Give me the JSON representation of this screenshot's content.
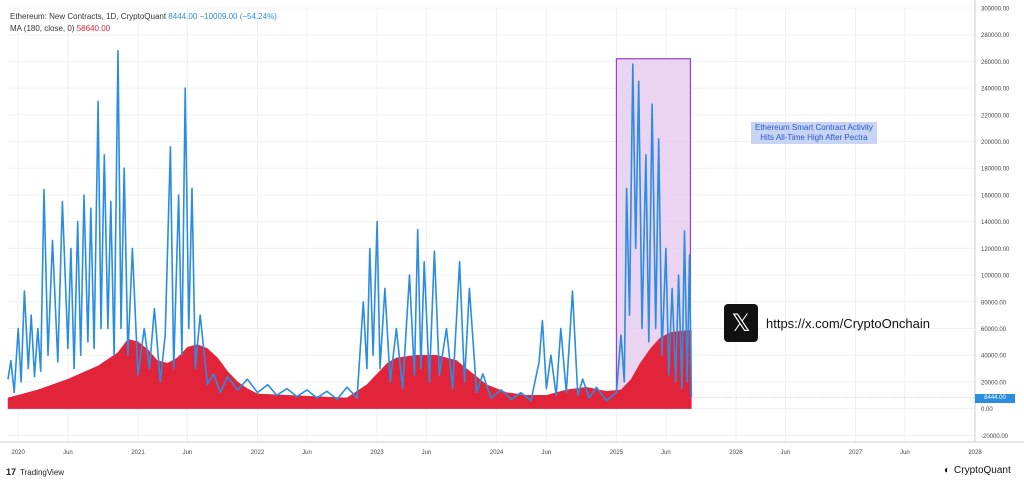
{
  "legend": {
    "title": "Ethereum: New Contracts, 1D, CryptoQuant",
    "last_value": "8444.00",
    "change": "−10009.00 (−54.24%)",
    "ma_label": "MA (180, close, 0)",
    "ma_value": "58640.00"
  },
  "annotation": {
    "line1": "Ethereum Smart Contract Activity",
    "line2": "Hits All-Time High After Pectra"
  },
  "social": {
    "icon": "x-logo-icon",
    "url": "https://x.com/CryptoOnchain"
  },
  "footer": {
    "tradingview": "TradingView",
    "cryptoquant": "CryptoQuant"
  },
  "colors": {
    "contracts": "#2a8de0",
    "ma": "#e2243b",
    "highlight_fill": "#e7cdf0",
    "highlight_border": "#9c3fc9",
    "annotation_bg": "#c7d5f2"
  },
  "chart_data": {
    "type": "line",
    "title": "Ethereum: New Contracts, 1D, CryptoQuant",
    "ylim": [
      -25000,
      300000
    ],
    "xlim": [
      "2019-12-01",
      "2028-01-01"
    ],
    "y_ticks": [
      {
        "value": 300000,
        "label": "300000.00"
      },
      {
        "value": 280000,
        "label": "280000.00"
      },
      {
        "value": 260000,
        "label": "260000.00"
      },
      {
        "value": 240000,
        "label": "240000.00"
      },
      {
        "value": 220000,
        "label": "220000.00"
      },
      {
        "value": 200000,
        "label": "200000.00"
      },
      {
        "value": 180000,
        "label": "180000.00"
      },
      {
        "value": 160000,
        "label": "160000.00"
      },
      {
        "value": 140000,
        "label": "140000.00"
      },
      {
        "value": 120000,
        "label": "120000.00"
      },
      {
        "value": 100000,
        "label": "100000.00"
      },
      {
        "value": 80000,
        "label": "80000.00"
      },
      {
        "value": 60000,
        "label": "60000.00"
      },
      {
        "value": 40000,
        "label": "40000.00"
      },
      {
        "value": 20000,
        "label": "20000.00"
      },
      {
        "value": 0,
        "label": "0.00"
      },
      {
        "value": -20000,
        "label": "-20000.00"
      }
    ],
    "x_ticks": [
      {
        "date": "2020-01-01",
        "label": "2020"
      },
      {
        "date": "2020-06-01",
        "label": "Jun"
      },
      {
        "date": "2021-01-01",
        "label": "2021"
      },
      {
        "date": "2021-06-01",
        "label": "Jun"
      },
      {
        "date": "2022-01-01",
        "label": "2022"
      },
      {
        "date": "2022-06-01",
        "label": "Jun"
      },
      {
        "date": "2023-01-01",
        "label": "2023"
      },
      {
        "date": "2023-06-01",
        "label": "Jun"
      },
      {
        "date": "2024-01-01",
        "label": "2024"
      },
      {
        "date": "2024-06-01",
        "label": "Jun"
      },
      {
        "date": "2025-01-01",
        "label": "2025"
      },
      {
        "date": "2025-06-01",
        "label": "Jun"
      },
      {
        "date": "2026-01-01",
        "label": "2026"
      },
      {
        "date": "2026-06-01",
        "label": "Jun"
      },
      {
        "date": "2027-01-01",
        "label": "2027"
      },
      {
        "date": "2027-06-01",
        "label": "Jun"
      },
      {
        "date": "2028-01-01",
        "label": "2028"
      }
    ],
    "highlight": {
      "start": "2025-01-01",
      "end": "2025-08-15",
      "y_low": 6000,
      "y_high": 262000
    },
    "last_value_label": "8444.00",
    "series": [
      {
        "name": "Ethereum: New Contracts",
        "style": "line",
        "points": [
          [
            "2019-12-01",
            22000
          ],
          [
            "2019-12-10",
            36000
          ],
          [
            "2019-12-20",
            12000
          ],
          [
            "2020-01-01",
            60000
          ],
          [
            "2020-01-10",
            20000
          ],
          [
            "2020-01-20",
            88000
          ],
          [
            "2020-02-01",
            30000
          ],
          [
            "2020-02-10",
            70000
          ],
          [
            "2020-02-20",
            24000
          ],
          [
            "2020-03-01",
            60000
          ],
          [
            "2020-03-10",
            28000
          ],
          [
            "2020-03-20",
            164000
          ],
          [
            "2020-04-01",
            40000
          ],
          [
            "2020-04-15",
            126000
          ],
          [
            "2020-05-01",
            35000
          ],
          [
            "2020-05-15",
            155000
          ],
          [
            "2020-06-01",
            45000
          ],
          [
            "2020-06-10",
            120000
          ],
          [
            "2020-06-20",
            30000
          ],
          [
            "2020-07-01",
            140000
          ],
          [
            "2020-07-10",
            40000
          ],
          [
            "2020-07-20",
            160000
          ],
          [
            "2020-08-01",
            50000
          ],
          [
            "2020-08-10",
            150000
          ],
          [
            "2020-08-20",
            45000
          ],
          [
            "2020-09-01",
            230000
          ],
          [
            "2020-09-10",
            60000
          ],
          [
            "2020-09-20",
            190000
          ],
          [
            "2020-10-01",
            60000
          ],
          [
            "2020-10-10",
            155000
          ],
          [
            "2020-10-20",
            40000
          ],
          [
            "2020-11-01",
            268000
          ],
          [
            "2020-11-10",
            60000
          ],
          [
            "2020-11-20",
            180000
          ],
          [
            "2020-12-01",
            40000
          ],
          [
            "2020-12-15",
            120000
          ],
          [
            "2021-01-01",
            25000
          ],
          [
            "2021-01-20",
            60000
          ],
          [
            "2021-02-05",
            30000
          ],
          [
            "2021-02-20",
            75000
          ],
          [
            "2021-03-10",
            20000
          ],
          [
            "2021-03-25",
            55000
          ],
          [
            "2021-04-10",
            196000
          ],
          [
            "2021-04-20",
            30000
          ],
          [
            "2021-05-05",
            160000
          ],
          [
            "2021-05-15",
            40000
          ],
          [
            "2021-05-25",
            240000
          ],
          [
            "2021-06-05",
            60000
          ],
          [
            "2021-06-15",
            165000
          ],
          [
            "2021-06-25",
            30000
          ],
          [
            "2021-07-10",
            70000
          ],
          [
            "2021-08-01",
            18000
          ],
          [
            "2021-08-20",
            26000
          ],
          [
            "2021-09-10",
            12000
          ],
          [
            "2021-10-01",
            24000
          ],
          [
            "2021-11-01",
            14000
          ],
          [
            "2021-12-01",
            22000
          ],
          [
            "2022-01-01",
            12000
          ],
          [
            "2022-02-01",
            18000
          ],
          [
            "2022-03-01",
            10000
          ],
          [
            "2022-04-01",
            15000
          ],
          [
            "2022-05-01",
            9000
          ],
          [
            "2022-06-01",
            14000
          ],
          [
            "2022-07-01",
            8000
          ],
          [
            "2022-08-01",
            13000
          ],
          [
            "2022-09-01",
            7000
          ],
          [
            "2022-10-01",
            16000
          ],
          [
            "2022-11-01",
            8000
          ],
          [
            "2022-11-20",
            80000
          ],
          [
            "2022-12-01",
            30000
          ],
          [
            "2022-12-10",
            120000
          ],
          [
            "2022-12-20",
            40000
          ],
          [
            "2023-01-01",
            140000
          ],
          [
            "2023-01-10",
            30000
          ],
          [
            "2023-01-25",
            90000
          ],
          [
            "2023-02-10",
            20000
          ],
          [
            "2023-03-01",
            60000
          ],
          [
            "2023-03-20",
            15000
          ],
          [
            "2023-04-10",
            100000
          ],
          [
            "2023-04-25",
            25000
          ],
          [
            "2023-05-05",
            134000
          ],
          [
            "2023-05-15",
            30000
          ],
          [
            "2023-05-25",
            110000
          ],
          [
            "2023-06-10",
            20000
          ],
          [
            "2023-06-25",
            118000
          ],
          [
            "2023-07-10",
            25000
          ],
          [
            "2023-08-01",
            60000
          ],
          [
            "2023-08-20",
            15000
          ],
          [
            "2023-09-10",
            110000
          ],
          [
            "2023-09-25",
            20000
          ],
          [
            "2023-10-10",
            90000
          ],
          [
            "2023-11-01",
            12000
          ],
          [
            "2023-11-20",
            26000
          ],
          [
            "2023-12-15",
            8000
          ],
          [
            "2024-01-15",
            14000
          ],
          [
            "2024-02-15",
            7000
          ],
          [
            "2024-03-15",
            12000
          ],
          [
            "2024-04-15",
            6000
          ],
          [
            "2024-05-10",
            35000
          ],
          [
            "2024-05-20",
            66000
          ],
          [
            "2024-06-01",
            15000
          ],
          [
            "2024-06-15",
            40000
          ],
          [
            "2024-07-01",
            10000
          ],
          [
            "2024-07-15",
            60000
          ],
          [
            "2024-08-01",
            12000
          ],
          [
            "2024-08-20",
            88000
          ],
          [
            "2024-09-05",
            10000
          ],
          [
            "2024-09-20",
            22000
          ],
          [
            "2024-10-10",
            8000
          ],
          [
            "2024-11-01",
            16000
          ],
          [
            "2024-12-01",
            6000
          ],
          [
            "2025-01-01",
            12000
          ],
          [
            "2025-01-15",
            55000
          ],
          [
            "2025-01-25",
            20000
          ],
          [
            "2025-02-01",
            165000
          ],
          [
            "2025-02-10",
            70000
          ],
          [
            "2025-02-20",
            258000
          ],
          [
            "2025-03-01",
            120000
          ],
          [
            "2025-03-10",
            245000
          ],
          [
            "2025-03-20",
            60000
          ],
          [
            "2025-04-01",
            190000
          ],
          [
            "2025-04-10",
            50000
          ],
          [
            "2025-04-20",
            228000
          ],
          [
            "2025-05-01",
            60000
          ],
          [
            "2025-05-10",
            202000
          ],
          [
            "2025-05-20",
            40000
          ],
          [
            "2025-06-01",
            120000
          ],
          [
            "2025-06-10",
            25000
          ],
          [
            "2025-06-20",
            90000
          ],
          [
            "2025-07-01",
            20000
          ],
          [
            "2025-07-10",
            100000
          ],
          [
            "2025-07-20",
            15000
          ],
          [
            "2025-07-28",
            133000
          ],
          [
            "2025-08-05",
            20000
          ],
          [
            "2025-08-12",
            115000
          ],
          [
            "2025-08-18",
            8444
          ]
        ]
      },
      {
        "name": "MA (180, close, 0)",
        "style": "area",
        "points": [
          [
            "2019-12-01",
            8000
          ],
          [
            "2020-03-01",
            14000
          ],
          [
            "2020-06-01",
            22000
          ],
          [
            "2020-09-01",
            32000
          ],
          [
            "2020-11-01",
            42000
          ],
          [
            "2020-12-01",
            52000
          ],
          [
            "2021-01-01",
            50000
          ],
          [
            "2021-02-01",
            44000
          ],
          [
            "2021-03-01",
            36000
          ],
          [
            "2021-04-01",
            34000
          ],
          [
            "2021-05-01",
            38000
          ],
          [
            "2021-06-01",
            46000
          ],
          [
            "2021-07-01",
            48000
          ],
          [
            "2021-08-01",
            45000
          ],
          [
            "2021-09-01",
            38000
          ],
          [
            "2021-10-01",
            28000
          ],
          [
            "2021-11-01",
            20000
          ],
          [
            "2021-12-01",
            15000
          ],
          [
            "2022-01-01",
            11000
          ],
          [
            "2022-04-01",
            10000
          ],
          [
            "2022-07-01",
            9000
          ],
          [
            "2022-10-01",
            8000
          ],
          [
            "2022-12-01",
            18000
          ],
          [
            "2023-01-01",
            26000
          ],
          [
            "2023-02-01",
            34000
          ],
          [
            "2023-03-01",
            38000
          ],
          [
            "2023-05-01",
            40000
          ],
          [
            "2023-07-01",
            40000
          ],
          [
            "2023-09-01",
            36000
          ],
          [
            "2023-10-01",
            30000
          ],
          [
            "2023-11-01",
            24000
          ],
          [
            "2023-12-01",
            18000
          ],
          [
            "2024-02-01",
            12000
          ],
          [
            "2024-04-01",
            10000
          ],
          [
            "2024-06-01",
            10000
          ],
          [
            "2024-08-01",
            14000
          ],
          [
            "2024-10-01",
            16000
          ],
          [
            "2024-12-01",
            13000
          ],
          [
            "2025-01-15",
            14000
          ],
          [
            "2025-02-15",
            22000
          ],
          [
            "2025-03-15",
            34000
          ],
          [
            "2025-04-15",
            45000
          ],
          [
            "2025-05-15",
            53000
          ],
          [
            "2025-06-15",
            57000
          ],
          [
            "2025-07-15",
            58000
          ],
          [
            "2025-08-18",
            58640
          ]
        ]
      }
    ]
  }
}
